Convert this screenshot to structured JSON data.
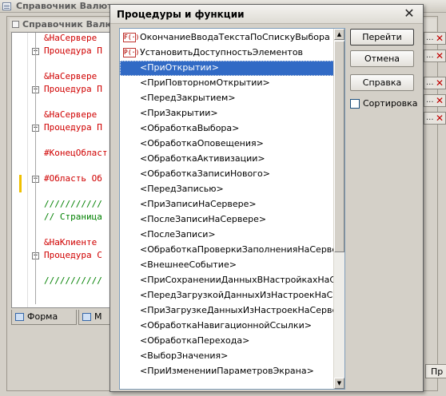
{
  "background_window": {
    "title": "Справочник Валют",
    "inner_title": "Справочник Валют",
    "code_lines": [
      {
        "text": "&НаСервере",
        "kind": "kw"
      },
      {
        "text": "Процедура П",
        "kind": "kw"
      },
      {
        "text": "&НаСервере",
        "kind": "kw"
      },
      {
        "text": "Процедура П",
        "kind": "kw"
      },
      {
        "text": "&НаСервере",
        "kind": "kw"
      },
      {
        "text": "Процедура П",
        "kind": "kw"
      },
      {
        "text": "#КонецОбласт",
        "kind": "kw"
      },
      {
        "text": "#Область Об",
        "kind": "kw"
      },
      {
        "text": "///////////",
        "kind": "cm"
      },
      {
        "text": "// Страница",
        "kind": "cm"
      },
      {
        "text": "&НаКлиенте",
        "kind": "kw"
      },
      {
        "text": "Процедура С",
        "kind": "kw"
      },
      {
        "text": "///////////",
        "kind": "cm"
      }
    ],
    "tabs": [
      {
        "label": "Форма"
      },
      {
        "label": "М"
      }
    ],
    "right_strip_items": [
      "...",
      "...",
      "...",
      "...",
      "..."
    ],
    "right_strip_button": "Пр"
  },
  "dialog": {
    "title": "Процедуры и функции",
    "buttons": {
      "go": "Перейти",
      "cancel": "Отмена",
      "help": "Справка"
    },
    "sort_label": "Сортировка",
    "sort_checked": false,
    "items": [
      {
        "text": "ОкончаниеВводаТекстаПоСпискуВыбора",
        "icon": "F(·)"
      },
      {
        "text": "УстановитьДоступностьЭлементов",
        "icon": "P(·)"
      },
      {
        "text": "<ПриОткрытии>",
        "selected": true
      },
      {
        "text": "<ПриПовторномОткрытии>"
      },
      {
        "text": "<ПередЗакрытием>"
      },
      {
        "text": "<ПриЗакрытии>"
      },
      {
        "text": "<ОбработкаВыбора>"
      },
      {
        "text": "<ОбработкаОповещения>"
      },
      {
        "text": "<ОбработкаАктивизации>"
      },
      {
        "text": "<ОбработкаЗаписиНового>"
      },
      {
        "text": "<ПередЗаписью>"
      },
      {
        "text": "<ПриЗаписиНаСервере>"
      },
      {
        "text": "<ПослеЗаписиНаСервере>"
      },
      {
        "text": "<ПослеЗаписи>"
      },
      {
        "text": "<ОбработкаПроверкиЗаполненияНаСервере>"
      },
      {
        "text": "<ВнешнееСобытие>"
      },
      {
        "text": "<ПриСохраненииДанныхВНастройкахНаСер..."
      },
      {
        "text": "<ПередЗагрузкойДанныхИзНастроекНаСерв..."
      },
      {
        "text": "<ПриЗагрузкеДанныхИзНастроекНаСервер..."
      },
      {
        "text": "<ОбработкаНавигационнойСсылки>"
      },
      {
        "text": "<ОбработкаПерехода>"
      },
      {
        "text": "<ВыборЗначения>"
      },
      {
        "text": "<ПриИзмененииПараметровЭкрана>"
      }
    ]
  }
}
